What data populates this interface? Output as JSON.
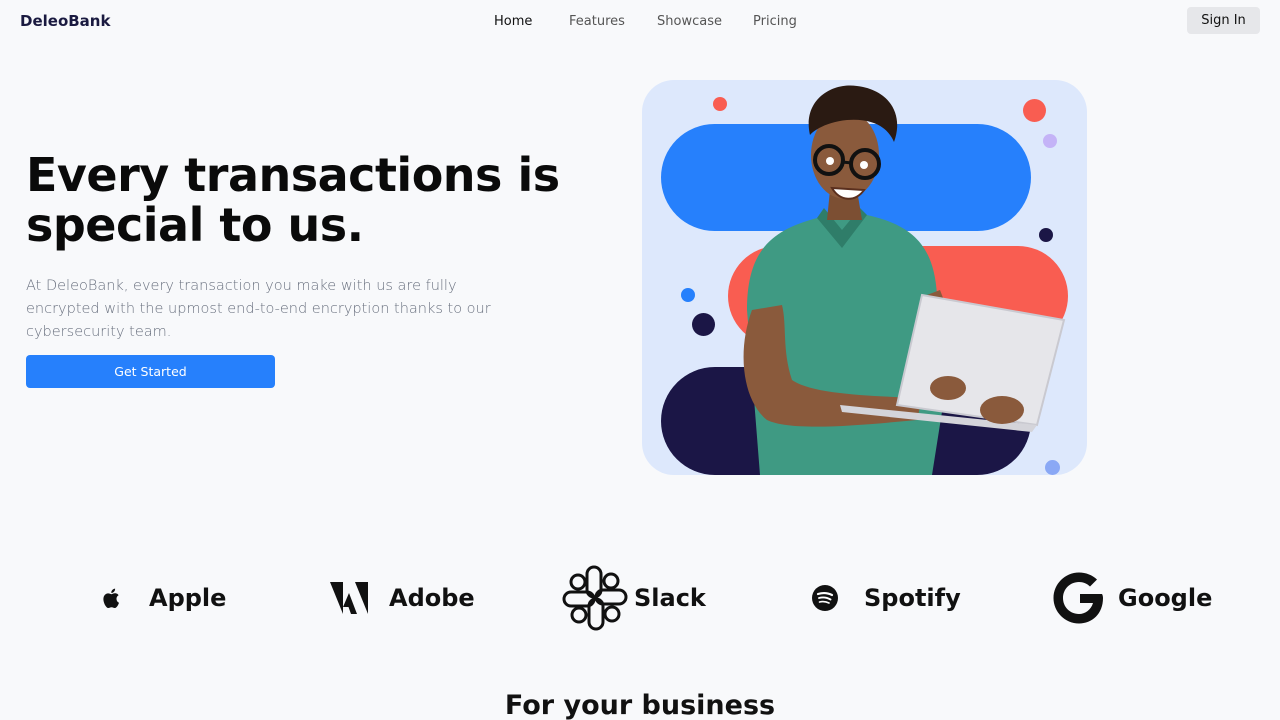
{
  "brand": "DeleoBank",
  "nav": {
    "links": [
      "Home",
      "Features",
      "Showcase",
      "Pricing"
    ],
    "active": "Home",
    "sign_in": "Sign In"
  },
  "hero": {
    "title": "Every transactions is special to us.",
    "description": "At DeleoBank, every transaction you make with us are fully encrypted with the upmost end-to-end encryption thanks to our cybersecurity team.",
    "cta": "Get Started"
  },
  "partners": [
    "Apple",
    "Adobe",
    "Slack",
    "Spotify",
    "Google"
  ],
  "section": {
    "title": "For your business"
  },
  "colors": {
    "accent": "#2680fc",
    "coral": "#f95d51",
    "navy": "#1b1646",
    "art_bg": "#dde8fc",
    "lavender": "#c4b3f7",
    "shirt": "#3f9a83"
  },
  "icons": [
    "apple-icon",
    "adobe-icon",
    "slack-icon",
    "spotify-icon",
    "google-icon"
  ]
}
